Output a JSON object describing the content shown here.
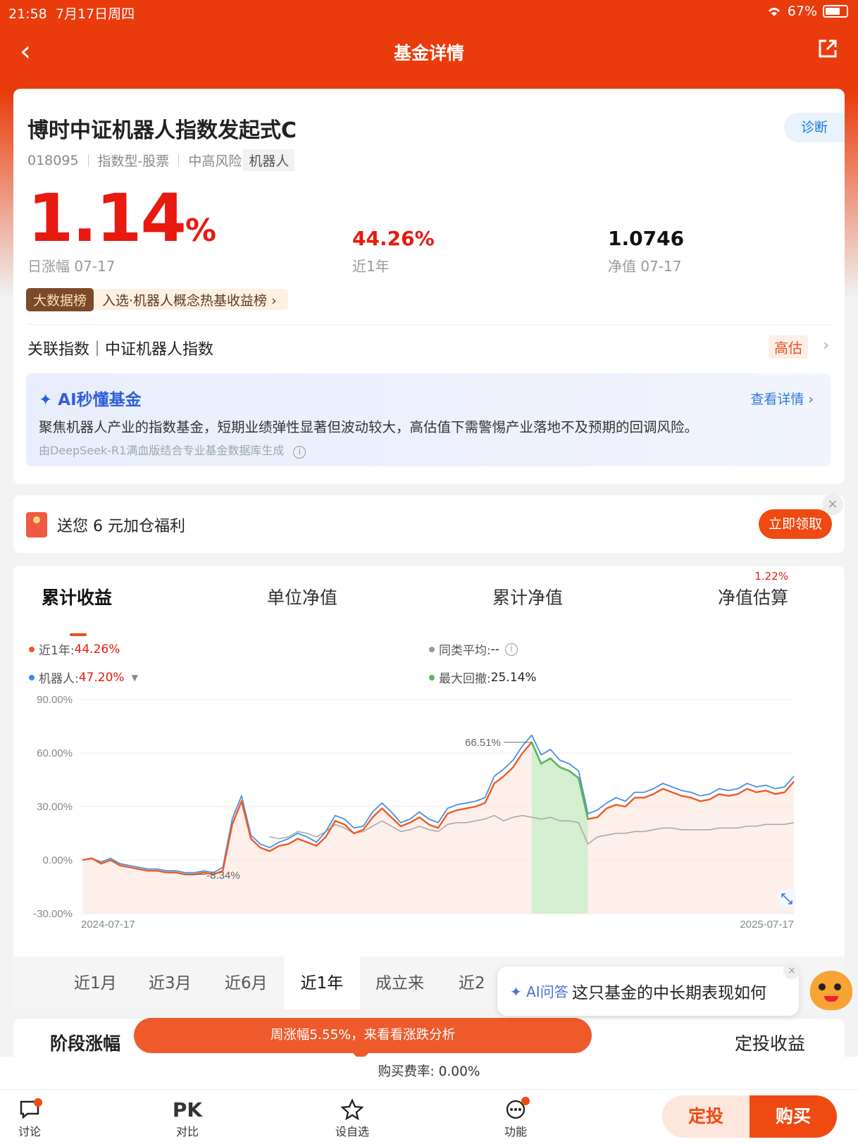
{
  "status": {
    "time": "21:58",
    "date": "7月17日周四",
    "battery": "67%"
  },
  "nav": {
    "title": "基金详情"
  },
  "fund": {
    "name": "博时中证机器人指数发起式C",
    "diagnose": "诊断",
    "code": "018095",
    "type": "指数型-股票",
    "risk": "中高风险",
    "tag": "机器人",
    "daily_change": "1.14",
    "daily_change_unit": "%",
    "daily_label": "日涨幅 07-17",
    "year_change": "44.26%",
    "year_label": "近1年",
    "nav_value": "1.0746",
    "nav_label": "净值 07-17",
    "bigdata_badge": "大数据榜",
    "bigdata_text": "入选·机器人概念热基收益榜 ›",
    "index_text": "关联指数｜中证机器人指数",
    "valuation": "高估",
    "ai_title": "AI秒懂基金",
    "ai_more": "查看详情 ›",
    "ai_summary": "聚焦机器人产业的指数基金，短期业绩弹性显著但波动较大，高估值下需警惕产业落地不及预期的回调风险。",
    "ai_source": "由DeepSeek-R1满血版结合专业基金数据库生成"
  },
  "gift": {
    "text": "送您 6 元加仓福利",
    "button": "立即领取",
    "close": "×"
  },
  "chart_tabs": {
    "items": [
      "累计收益",
      "单位净值",
      "累计净值",
      "净值估算"
    ],
    "estimate_badge": "1.22%"
  },
  "legend": {
    "fund_label": "近1年:",
    "fund_value": "44.26%",
    "peer_label": "同类平均:",
    "peer_value": "--",
    "index_label": "机器人:",
    "index_value": "47.20%",
    "drawdown_label": "最大回撤:",
    "drawdown_value": "25.14%"
  },
  "periods": [
    "近1月",
    "近3月",
    "近6月",
    "近1年",
    "成立来",
    "近2"
  ],
  "colors": {
    "brand": "#ea3b0c",
    "fund_line": "#ee5a22",
    "index_line": "#4a90e2",
    "peer_line": "#aaaaaa",
    "drawdown": "#5cb85c",
    "up": "#e8190e"
  },
  "chart_data": {
    "type": "line",
    "ylim": [
      -30,
      90
    ],
    "yticks": [
      "90.00%",
      "60.00%",
      "30.00%",
      "0.00%",
      "-30.00%"
    ],
    "x_start": "2024-07-17",
    "x_end": "2025-07-17",
    "annotations": [
      "66.51%",
      "-8.34%"
    ],
    "series": [
      {
        "name": "近1年",
        "values": [
          0,
          1,
          -2,
          0,
          -3,
          -4,
          -5,
          -6,
          -6,
          -7,
          -7,
          -8,
          -8,
          -7,
          -8,
          -6,
          20,
          33,
          12,
          7,
          5,
          8,
          9,
          12,
          10,
          8,
          13,
          22,
          20,
          15,
          17,
          24,
          29,
          24,
          19,
          21,
          24,
          20,
          18,
          26,
          28,
          29,
          30,
          32,
          43,
          47,
          52,
          60,
          66,
          54,
          57,
          52,
          50,
          46,
          23,
          24,
          29,
          31,
          30,
          35,
          35,
          37,
          40,
          38,
          36,
          35,
          33,
          34,
          37,
          36,
          37,
          40,
          38,
          39,
          37,
          38,
          44
        ]
      },
      {
        "name": "机器人",
        "values": [
          0,
          1,
          -1,
          1,
          -2,
          -3,
          -4,
          -5,
          -5,
          -6,
          -6,
          -7,
          -7,
          -6,
          -7,
          -4,
          23,
          36,
          14,
          9,
          7,
          10,
          12,
          15,
          13,
          10,
          16,
          25,
          23,
          18,
          19,
          27,
          32,
          27,
          21,
          23,
          27,
          23,
          21,
          29,
          31,
          32,
          33,
          35,
          47,
          51,
          56,
          64,
          70,
          59,
          62,
          56,
          54,
          50,
          26,
          28,
          32,
          35,
          33,
          38,
          38,
          40,
          43,
          41,
          39,
          38,
          36,
          37,
          40,
          39,
          40,
          43,
          41,
          42,
          40,
          41,
          47
        ]
      },
      {
        "name": "同类平均",
        "values": [
          null,
          null,
          null,
          null,
          null,
          null,
          null,
          null,
          null,
          null,
          null,
          null,
          null,
          null,
          null,
          null,
          null,
          null,
          null,
          null,
          13,
          12,
          13,
          16,
          15,
          13,
          16,
          20,
          18,
          15,
          16,
          19,
          22,
          19,
          16,
          17,
          19,
          17,
          16,
          20,
          21,
          21,
          22,
          23,
          25,
          22,
          24,
          25,
          24,
          23,
          24,
          22,
          22,
          21,
          9,
          13,
          14,
          15,
          15,
          16,
          16,
          17,
          18,
          18,
          17,
          17,
          17,
          17,
          18,
          18,
          18,
          19,
          19,
          20,
          20,
          20,
          21
        ]
      }
    ]
  },
  "stage": {
    "title": "阶段涨幅",
    "right": "定投收益"
  },
  "promo": "周涨幅5.55%，来看看涨跌分析",
  "fee": "购买费率: 0.00%",
  "ai_bubble": {
    "prefix": "AI问答",
    "question": "这只基金的中长期表现如何"
  },
  "bottom": {
    "discuss": "讨论",
    "compare": "对比",
    "compare_icon": "PK",
    "watch": "设自选",
    "func": "功能",
    "plan": "定投",
    "buy": "购买"
  }
}
